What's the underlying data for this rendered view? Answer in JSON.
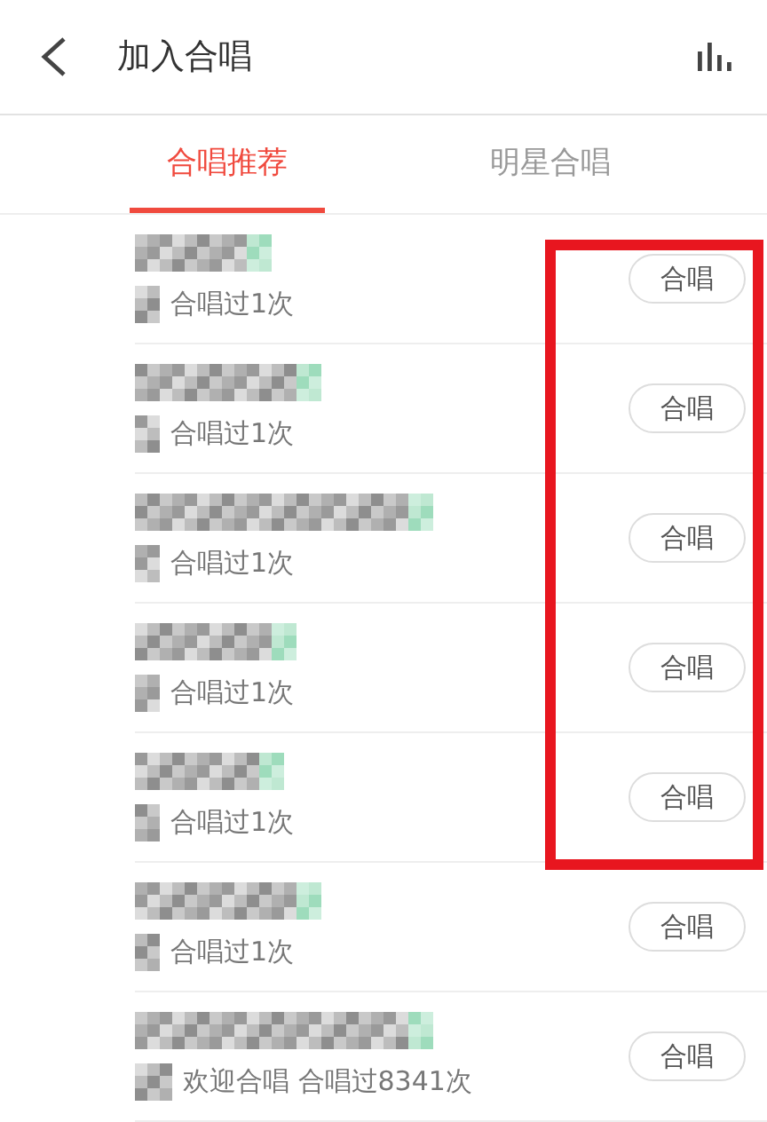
{
  "header": {
    "title": "加入合唱"
  },
  "tabs": [
    {
      "label": "合唱推荐",
      "selected": true
    },
    {
      "label": "明星合唱",
      "selected": false
    }
  ],
  "rows": [
    {
      "subtitle": "合唱过1次",
      "button": "合唱",
      "highlighted": true
    },
    {
      "subtitle": "合唱过1次",
      "button": "合唱",
      "highlighted": true
    },
    {
      "subtitle": "合唱过1次",
      "button": "合唱",
      "highlighted": true
    },
    {
      "subtitle": "合唱过1次",
      "button": "合唱",
      "highlighted": true
    },
    {
      "subtitle": "合唱过1次",
      "button": "合唱",
      "highlighted": true
    },
    {
      "subtitle": "合唱过1次",
      "button": "合唱",
      "highlighted": false
    },
    {
      "subtitle": "欢迎合唱 合唱过8341次",
      "button": "合唱",
      "highlighted": false
    }
  ]
}
